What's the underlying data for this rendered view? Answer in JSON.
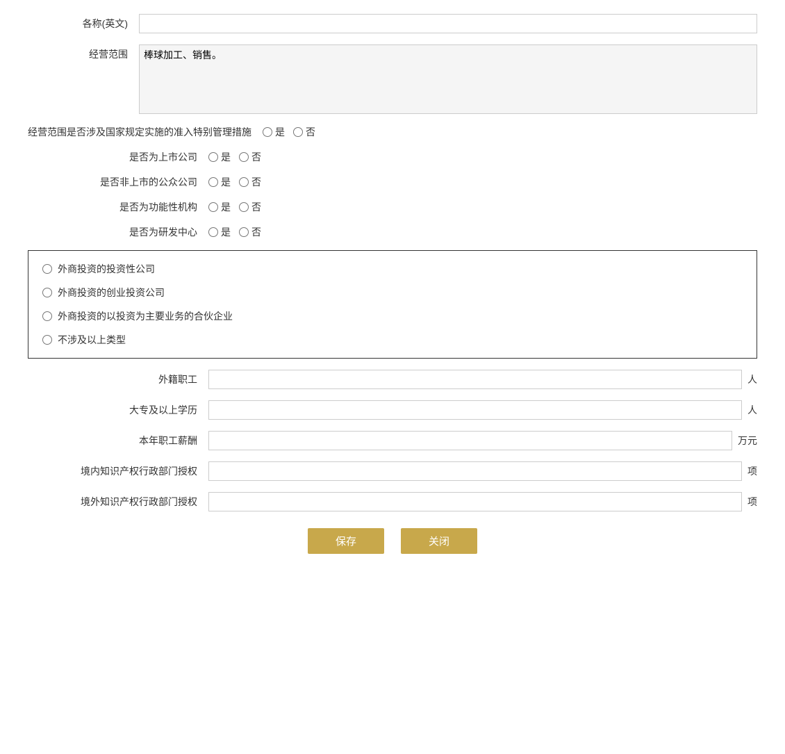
{
  "form": {
    "labels": {
      "name_en": "各称(英文)",
      "business_scope": "经营范围",
      "business_scope_special": "经营范围是否涉及国家规定实施的准入特别管理措施",
      "is_listed": "是否为上市公司",
      "is_public_unlisted": "是否非上市的公众公司",
      "is_functional": "是否为功能性机构",
      "is_rd_center": "是否为研发中心",
      "foreign_employees": "外籍职工",
      "college_above": "大专及以上学历",
      "annual_salary": "本年职工薪酬",
      "domestic_ip": "境内知识产权行政部门授权",
      "foreign_ip": "境外知识产权行政部门授权"
    },
    "units": {
      "person": "人",
      "wan_yuan": "万元",
      "xiang": "项"
    },
    "radio_options": {
      "yes": "是",
      "no": "否"
    },
    "business_scope_text": "棒球加工、销售。",
    "investment_types": [
      "外商投资的投资性公司",
      "外商投资的创业投资公司",
      "外商投资的以投资为主要业务的合伙企业",
      "不涉及以上类型"
    ],
    "buttons": {
      "save": "保存",
      "close": "关闭"
    }
  }
}
